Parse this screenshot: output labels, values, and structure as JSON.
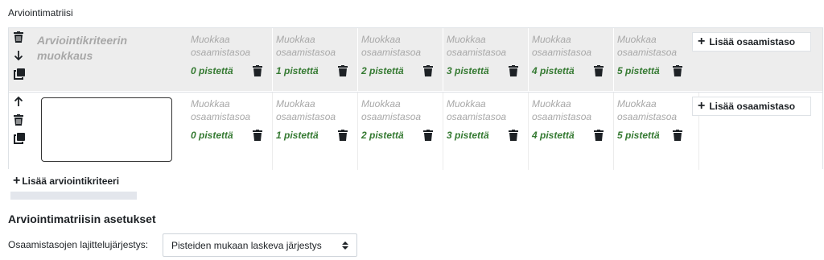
{
  "section_label": "Arviointimatriisi",
  "criteria": [
    {
      "description": "Arviointikriteerin muokkaus",
      "levels": [
        {
          "desc": "Muokkaa osaamistasoa",
          "score": "0 pistettä"
        },
        {
          "desc": "Muokkaa osaamistasoa",
          "score": "1 pistettä"
        },
        {
          "desc": "Muokkaa osaamistasoa",
          "score": "2 pistettä"
        },
        {
          "desc": "Muokkaa osaamistasoa",
          "score": "3 pistettä"
        },
        {
          "desc": "Muokkaa osaamistasoa",
          "score": "4 pistettä"
        },
        {
          "desc": "Muokkaa osaamistasoa",
          "score": "5 pistettä"
        }
      ],
      "add_level_label": "Lisää osaamistaso"
    },
    {
      "description_value": "",
      "levels": [
        {
          "desc": "Muokkaa osaamistasoa",
          "score": "0 pistettä"
        },
        {
          "desc": "Muokkaa osaamistasoa",
          "score": "1 pistettä"
        },
        {
          "desc": "Muokkaa osaamistasoa",
          "score": "2 pistettä"
        },
        {
          "desc": "Muokkaa osaamistasoa",
          "score": "3 pistettä"
        },
        {
          "desc": "Muokkaa osaamistasoa",
          "score": "4 pistettä"
        },
        {
          "desc": "Muokkaa osaamistasoa",
          "score": "5 pistettä"
        }
      ],
      "add_level_label": "Lisää osaamistaso"
    }
  ],
  "add_criterion_label": "Lisää arviointikriteeri",
  "settings": {
    "heading": "Arviointimatriisin asetukset",
    "sort_label": "Osaamistasojen lajittelujärjestys:",
    "sort_value": "Pisteiden mukaan laskeva järjestys"
  },
  "colors": {
    "score": "#357a32",
    "placeholder": "#a8a8a8",
    "row_bg": "#ededed"
  },
  "icons": [
    "trash-icon",
    "arrow-down-icon",
    "arrow-up-icon",
    "duplicate-icon",
    "plus-icon",
    "select-arrows-icon"
  ]
}
